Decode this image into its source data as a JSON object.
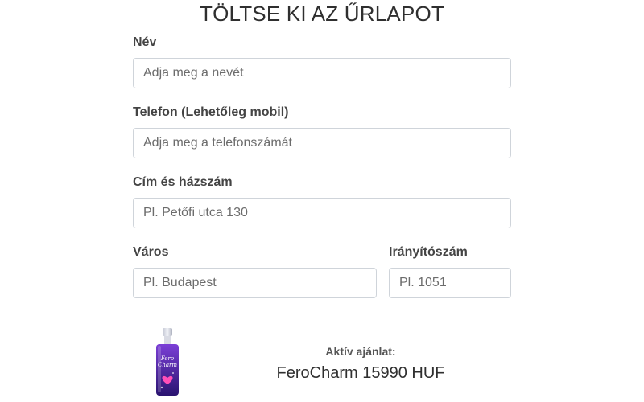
{
  "form": {
    "title": "TÖLTSE KI AZ ŰRLAPOT",
    "name_label": "Név",
    "name_placeholder": "Adja meg a nevét",
    "phone_label": "Telefon (Lehetőleg mobil)",
    "phone_placeholder": "Adja meg a telefonszámát",
    "address_label": "Cím és házszám",
    "address_placeholder": "Pl. Petőfi utca 130",
    "city_label": "Város",
    "city_placeholder": "Pl. Budapest",
    "zip_label": "Irányítószám",
    "zip_placeholder": "Pl. 1051"
  },
  "offer": {
    "label": "Aktív ajánlat:",
    "product_line": "FeroCharm 15990 HUF",
    "product_name_on_bottle": "Fero Charm",
    "bottle_colors": {
      "cap": "#e8e8f0",
      "body_top": "#7b3fd6",
      "body_bottom": "#3b1a8c",
      "accent": "#ff4fb8"
    }
  }
}
